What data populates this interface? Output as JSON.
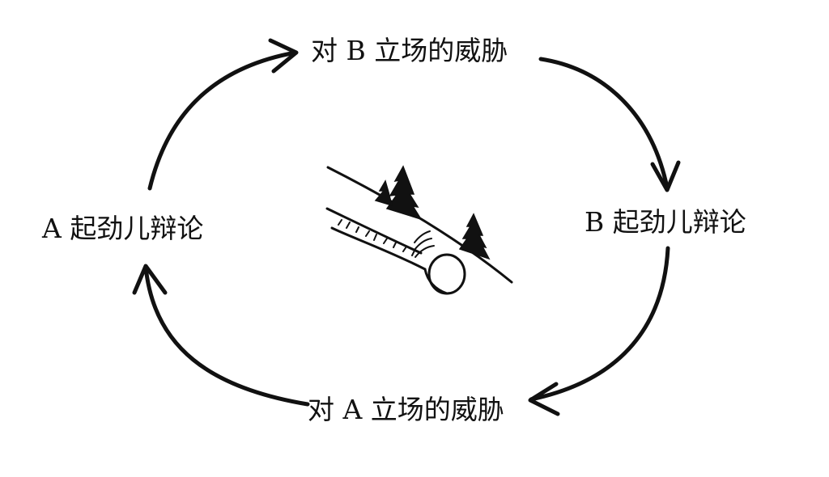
{
  "diagram": {
    "nodes": {
      "top": "对 B 立场的威胁",
      "right": "B 起劲儿辩论",
      "bottom": "对 A 立场的威胁",
      "left": "A 起劲儿辩论"
    },
    "cycle": [
      "top",
      "right",
      "bottom",
      "left"
    ],
    "center_illustration": "snowball-rolling-downhill",
    "colors": {
      "ink": "#111111",
      "background": "#ffffff"
    }
  }
}
